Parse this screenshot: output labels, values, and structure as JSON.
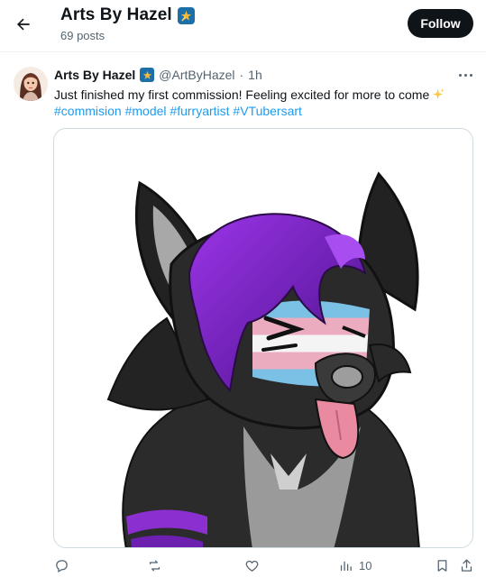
{
  "header": {
    "title": "Arts By Hazel",
    "posts_count": "69 posts",
    "follow_label": "Follow"
  },
  "post": {
    "author": "Arts By Hazel",
    "handle": "@ArtByHazel",
    "separator": "·",
    "time": "1h",
    "text": "Just finished my first commission! Feeling excited for more to come",
    "hashtags": [
      "#commision",
      "#model",
      "#furryartist",
      "#VTubersart"
    ]
  },
  "actions": {
    "views_count": "10"
  },
  "colors": {
    "accent": "#1d9bf0",
    "text_primary": "#0f1419",
    "text_secondary": "#536471",
    "follow_bg": "#0f1419",
    "badge": "#1d6fa8"
  },
  "icons": [
    "back-arrow-icon",
    "verified-badge-icon",
    "more-dots-icon",
    "sparkle-icon",
    "reply-icon",
    "repost-icon",
    "like-icon",
    "views-icon",
    "bookmark-icon",
    "share-icon"
  ]
}
